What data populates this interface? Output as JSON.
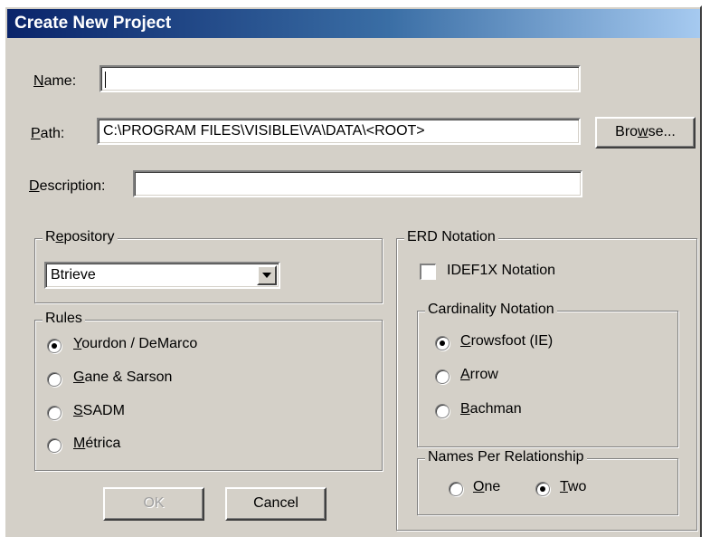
{
  "window": {
    "title": "Create New Project"
  },
  "form": {
    "name_label_key": "N",
    "name_label_rest": "ame:",
    "name_value": "",
    "path_label_key": "P",
    "path_label_rest": "ath:",
    "path_value": "C:\\PROGRAM FILES\\VISIBLE\\VA\\DATA\\<ROOT>",
    "browse_pre": "Bro",
    "browse_key": "w",
    "browse_post": "se...",
    "desc_label_key": "D",
    "desc_label_rest": "escription:",
    "desc_value": ""
  },
  "repository": {
    "title_pre": "R",
    "title_key": "e",
    "title_post": "pository",
    "selected": "Btrieve"
  },
  "rules": {
    "title": "Rules",
    "options": [
      {
        "key": "Y",
        "rest": "ourdon / DeMarco",
        "checked": true
      },
      {
        "key": "G",
        "rest": "ane & Sarson",
        "checked": false
      },
      {
        "key": "S",
        "rest": "SADM",
        "checked": false
      },
      {
        "key": "M",
        "rest": "étrica",
        "checked": false
      }
    ]
  },
  "erd": {
    "title": "ERD Notation",
    "idef_label": "IDEF1X Notation",
    "idef_checked": false,
    "cardinality_title": "Cardinality Notation",
    "cardinality": [
      {
        "key": "C",
        "rest": "rowsfoot (IE)",
        "checked": true
      },
      {
        "key": "A",
        "rest": "rrow",
        "checked": false
      },
      {
        "key": "B",
        "rest": "achman",
        "checked": false
      }
    ],
    "names_title": "Names Per Relationship",
    "names": [
      {
        "key": "O",
        "rest": "ne",
        "checked": false
      },
      {
        "key": "T",
        "rest": "wo",
        "checked": true
      }
    ]
  },
  "buttons": {
    "ok": "OK",
    "cancel": "Cancel"
  }
}
